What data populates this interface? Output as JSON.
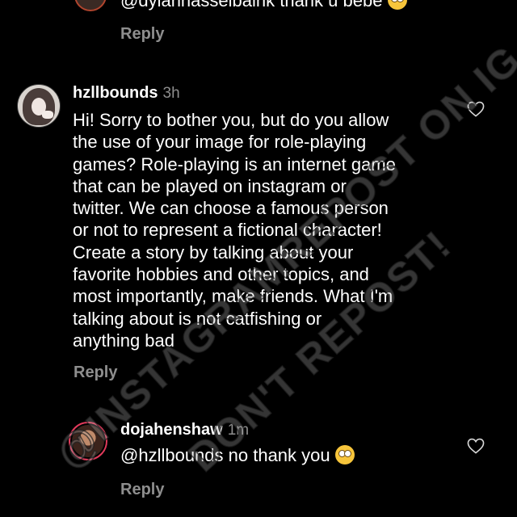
{
  "top_comment": {
    "text": "@dylanhasselbaink thank u bebe",
    "reply_label": "Reply"
  },
  "main_comment": {
    "username": "hzllbounds",
    "time": "3h",
    "lines": [
      "Hi! Sorry to bother you, but do you allow",
      "the use of your image for role-playing",
      "games? Role-playing is an internet game",
      "that can be played on instagram or",
      "twitter. We can choose a famous person",
      "or not to represent a fictional character!",
      "Create a story by talking about your",
      "favorite hobbies and other topics, and",
      "most importantly, make friends. What I'm",
      "talking about is not catfishing or",
      "anything bad"
    ],
    "reply_label": "Reply"
  },
  "reply_comment": {
    "username": "dojahenshaw",
    "time": "1m",
    "text": "@hzllbounds no thank you",
    "reply_label": "Reply"
  },
  "watermark": {
    "line1": "@INSTAGRAMREPOST ON IG",
    "line2": "DON'T REPOST!"
  },
  "icons": {
    "heart": "heart-outline-icon",
    "emoji": "pleading-face-emoji"
  },
  "colors": {
    "background": "#000000",
    "text": "#ffffff",
    "muted": "#8e8e8e",
    "story_ring": "#e23a5b"
  }
}
